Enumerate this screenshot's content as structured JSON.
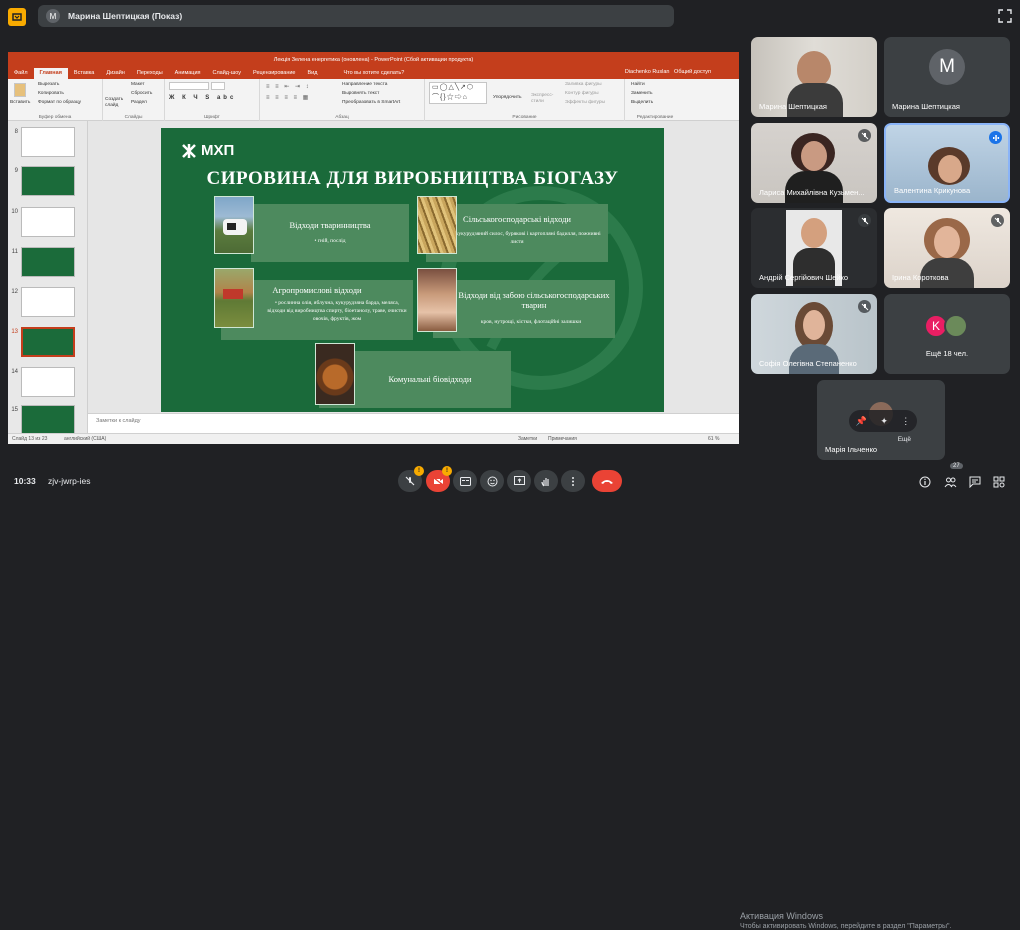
{
  "meet": {
    "presenter_chip": "Марина Шептицкая (Показ)",
    "presenter_initial": "М",
    "time": "10:33",
    "meeting_code": "zjv-jwrp-ies",
    "mic_badge": "!",
    "cam_badge": "!",
    "people_count": "27",
    "watermark_title": "Активация Windows",
    "watermark_sub": "Чтобы активировать Windows, перейдите в раздел \"Параметры\"."
  },
  "participants": [
    {
      "name": "Марина Шептицкая",
      "type": "video"
    },
    {
      "name": "Марина Шептицкая",
      "type": "avatar",
      "initial": "М"
    },
    {
      "name": "Лариса Михайлівна Кузьмен...",
      "type": "video",
      "muted": true
    },
    {
      "name": "Валентина Крикунова",
      "type": "video",
      "speaking": true
    },
    {
      "name": "Андрій Сергійович Шейко",
      "type": "video",
      "muted": true
    },
    {
      "name": "Ірина Короткова",
      "type": "video",
      "muted": true
    },
    {
      "name": "Софія Олегівна Степаненко",
      "type": "video",
      "muted": true
    },
    {
      "name": "Ещё 18 чел.",
      "type": "more",
      "initial": "K"
    },
    {
      "name": "Марія Ільченко",
      "type": "self",
      "more": "Ещё"
    }
  ],
  "ppt": {
    "title": "Лекція Зелена енергетика (оновлена) - PowerPoint (Сбой активации продукта)",
    "tabs": [
      "Файл",
      "Главная",
      "Вставка",
      "Дизайн",
      "Переходы",
      "Анимация",
      "Слайд-шоу",
      "Рецензирование",
      "Вид"
    ],
    "tell_me": "Что вы хотите сделать?",
    "user": "Diachenko Ruslan",
    "share": "Общий доступ",
    "ribbon": {
      "paste": "Вставить",
      "cut": "Вырезать",
      "copy": "Копировать",
      "format": "Формат по образцу",
      "clipboard": "Буфер обмена",
      "create": "Создать слайд",
      "layout": "Макет",
      "reset": "Сбросить",
      "section": "Раздел",
      "slides": "Слайды",
      "font": "Шрифт",
      "direction": "Направление текста",
      "align": "Выровнять текст",
      "smartart": "Преобразовать в SmartArt",
      "paragraph": "Абзац",
      "arrange": "Упорядочить",
      "styles": "Экспресс-стили",
      "fill": "Заливка фигуры",
      "outline": "Контур фигуры",
      "effects": "Эффекты фигуры",
      "drawing": "Рисование",
      "find": "Найти",
      "replace": "Заменить",
      "select": "Выделить",
      "editing": "Редактирование"
    },
    "thumb_numbers": [
      "8",
      "9",
      "10",
      "11",
      "12",
      "13",
      "14",
      "15"
    ],
    "selected_thumb": "13",
    "notes": "Заметки к слайду",
    "status_slide": "Слайд 13 из 23",
    "status_lang": "английский (США)",
    "status_notes": "Заметки",
    "status_comments": "Примечания",
    "zoom": "61 %"
  },
  "slide": {
    "logo": "МХП",
    "title": "СИРОВИНА ДЛЯ ВИРОБНИЦТВА БІОГАЗУ",
    "boxes": [
      {
        "head": "Відходи тваринництва",
        "body": "• гній, послід"
      },
      {
        "head": "Сільськогосподарські відходи",
        "body": "• солома, кукурудзяний силос, бурякові і картопляні бадилля, пожнивні листя"
      },
      {
        "head": "Агропромислові відходи",
        "body": "• рослинна олія, яблучна, кукурудзяна барда, меляса, відходи від виробництва спирту, біоетанолу, траве, очистки овочів, фруктів, жом"
      },
      {
        "head": "Відходи від забою сільськогосподарських тварин",
        "body": "кров, нутрощі, кістки, флотаційні залишки"
      },
      {
        "head": "Комунальні біовідходи",
        "body": ""
      }
    ]
  }
}
